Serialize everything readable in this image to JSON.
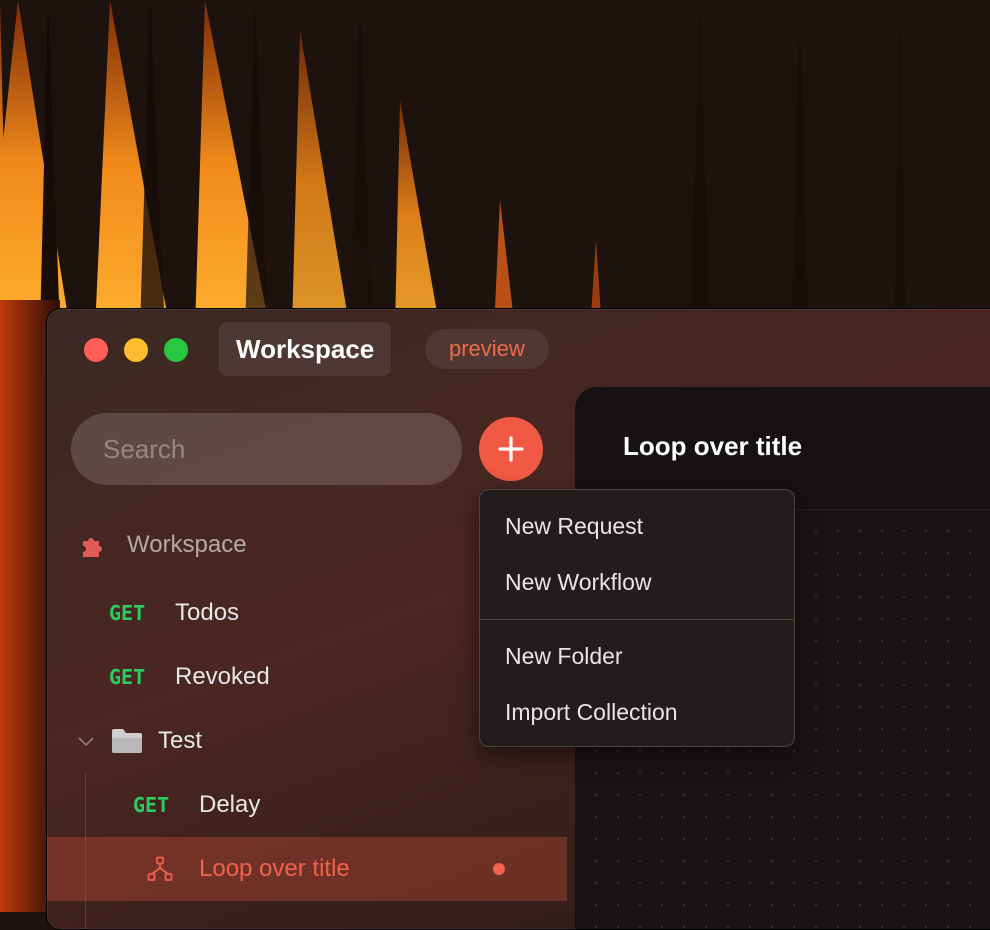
{
  "window": {
    "title": "Workspace",
    "badge": "preview"
  },
  "sidebar": {
    "search_placeholder": "Search",
    "workspace_label": "Workspace",
    "items": [
      {
        "method": "GET",
        "label": "Todos"
      },
      {
        "method": "GET",
        "label": "Revoked"
      },
      {
        "folder": "Test"
      },
      {
        "method": "GET",
        "label": "Delay"
      },
      {
        "label": "Loop over title",
        "active": true
      }
    ]
  },
  "main": {
    "title": "Loop over title"
  },
  "add_menu": {
    "items": [
      "New Request",
      "New Workflow",
      "New Folder",
      "Import Collection"
    ]
  },
  "colors": {
    "accent": "#f05a44",
    "get_method": "#2ecc5e",
    "close": "#ff5f57",
    "minimize": "#febc2e",
    "maximize": "#28c840"
  },
  "icons": {
    "workspace": "puzzle-icon",
    "folder": "folder-icon",
    "chevron": "chevron-down-icon",
    "workflow": "workflow-icon",
    "add": "plus-icon"
  }
}
